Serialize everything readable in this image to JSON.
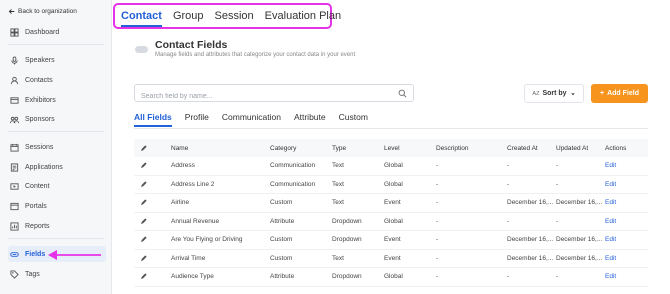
{
  "sidebar": {
    "back_label": "Back to organization",
    "items": [
      {
        "label": "Dashboard",
        "icon": "dashboard-icon"
      },
      {
        "label": "Speakers",
        "icon": "microphone-icon"
      },
      {
        "label": "Contacts",
        "icon": "contacts-icon"
      },
      {
        "label": "Exhibitors",
        "icon": "exhibitors-icon"
      },
      {
        "label": "Sponsors",
        "icon": "sponsors-icon"
      },
      {
        "label": "Sessions",
        "icon": "sessions-icon"
      },
      {
        "label": "Applications",
        "icon": "applications-icon"
      },
      {
        "label": "Content",
        "icon": "content-icon"
      },
      {
        "label": "Portals",
        "icon": "portals-icon"
      },
      {
        "label": "Reports",
        "icon": "reports-icon"
      },
      {
        "label": "Fields",
        "icon": "fields-icon",
        "active": true
      },
      {
        "label": "Tags",
        "icon": "tag-icon"
      }
    ]
  },
  "top_tabs": [
    "Contact",
    "Group",
    "Session",
    "Evaluation Plan"
  ],
  "header": {
    "title": "Contact Fields",
    "subtitle": "Manage fields and attributes that categorize your contact data in your event"
  },
  "search": {
    "placeholder": "Search field by name..."
  },
  "sort": {
    "prefix": "AZ",
    "label": "Sort by"
  },
  "add_field": {
    "label": "Add Field"
  },
  "sub_tabs": [
    "All Fields",
    "Profile",
    "Communication",
    "Attribute",
    "Custom"
  ],
  "table": {
    "columns": [
      "Name",
      "Category",
      "Type",
      "Level",
      "Description",
      "Created At",
      "Updated At",
      "Actions"
    ],
    "rows": [
      [
        "Address",
        "Communication",
        "Text",
        "Global",
        "-",
        "-",
        "-",
        "Edit"
      ],
      [
        "Address Line 2",
        "Communication",
        "Text",
        "Global",
        "-",
        "-",
        "-",
        "Edit"
      ],
      [
        "Airline",
        "Custom",
        "Text",
        "Event",
        "-",
        "December 16,...",
        "December 16,...",
        "Edit"
      ],
      [
        "Annual Revenue",
        "Attribute",
        "Dropdown",
        "Global",
        "-",
        "-",
        "-",
        "Edit"
      ],
      [
        "Are You Flying or Driving",
        "Custom",
        "Dropdown",
        "Event",
        "-",
        "December 16,...",
        "December 16,...",
        "Edit"
      ],
      [
        "Arrival Time",
        "Custom",
        "Text",
        "Event",
        "-",
        "December 16,...",
        "December 16,...",
        "Edit"
      ],
      [
        "Audience Type",
        "Attribute",
        "Dropdown",
        "Global",
        "-",
        "-",
        "-",
        "Edit"
      ]
    ]
  },
  "colors": {
    "accent": "#2361d8",
    "orange": "#f7941d",
    "highlight": "#e632e6"
  }
}
